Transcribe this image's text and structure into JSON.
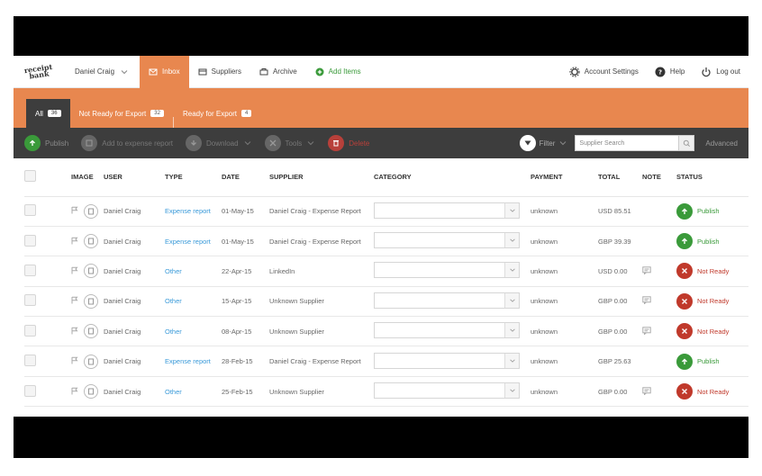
{
  "logo": {
    "line1": "receipt",
    "line2": "bank"
  },
  "topnav": {
    "user": "Daniel Craig",
    "tabs": [
      {
        "label": "Inbox",
        "icon": "inbox-icon"
      },
      {
        "label": "Suppliers",
        "icon": "suppliers-icon"
      },
      {
        "label": "Archive",
        "icon": "archive-icon"
      },
      {
        "label": "Add Items",
        "icon": "add-icon"
      }
    ],
    "right": [
      {
        "label": "Account Settings",
        "icon": "gear-icon"
      },
      {
        "label": "Help",
        "icon": "help-icon"
      },
      {
        "label": "Log out",
        "icon": "power-icon"
      }
    ]
  },
  "filter_tabs": [
    {
      "label": "All",
      "count": "36"
    },
    {
      "label": "Not Ready for Export",
      "count": "32"
    },
    {
      "label": "Ready for Export",
      "count": "4"
    }
  ],
  "toolbar": {
    "publish": "Publish",
    "add_to_report": "Add to expense report",
    "download": "Download",
    "tools": "Tools",
    "delete": "Delete",
    "filter": "Filter",
    "search_placeholder": "Supplier Search",
    "advanced": "Advanced"
  },
  "columns": {
    "image": "IMAGE",
    "user": "USER",
    "type": "TYPE",
    "date": "DATE",
    "supplier": "SUPPLIER",
    "category": "CATEGORY",
    "payment": "PAYMENT",
    "total": "TOTAL",
    "note": "NOTE",
    "status": "STATUS"
  },
  "rows": [
    {
      "user": "Daniel Craig",
      "type": "Expense report",
      "date": "01-May-15",
      "supplier": "Daniel Craig - Expense Report",
      "payment": "unknown",
      "total": "USD 85.51",
      "note": false,
      "status": "Publish",
      "status_kind": "publish"
    },
    {
      "user": "Daniel Craig",
      "type": "Expense report",
      "date": "01-May-15",
      "supplier": "Daniel Craig - Expense Report",
      "payment": "unknown",
      "total": "GBP 39.39",
      "note": false,
      "status": "Publish",
      "status_kind": "publish"
    },
    {
      "user": "Daniel Craig",
      "type": "Other",
      "date": "22-Apr-15",
      "supplier": "LinkedIn",
      "payment": "unknown",
      "total": "USD 0.00",
      "note": true,
      "status": "Not Ready",
      "status_kind": "notready"
    },
    {
      "user": "Daniel Craig",
      "type": "Other",
      "date": "15-Apr-15",
      "supplier": "Unknown Supplier",
      "payment": "unknown",
      "total": "GBP 0.00",
      "note": true,
      "status": "Not Ready",
      "status_kind": "notready"
    },
    {
      "user": "Daniel Craig",
      "type": "Other",
      "date": "08-Apr-15",
      "supplier": "Unknown Supplier",
      "payment": "unknown",
      "total": "GBP 0.00",
      "note": true,
      "status": "Not Ready",
      "status_kind": "notready"
    },
    {
      "user": "Daniel Craig",
      "type": "Expense report",
      "date": "28-Feb-15",
      "supplier": "Daniel Craig - Expense Report",
      "payment": "unknown",
      "total": "GBP 25.63",
      "note": false,
      "status": "Publish",
      "status_kind": "publish"
    },
    {
      "user": "Daniel Craig",
      "type": "Other",
      "date": "25-Feb-15",
      "supplier": "Unknown Supplier",
      "payment": "unknown",
      "total": "GBP 0.00",
      "note": true,
      "status": "Not Ready",
      "status_kind": "notready"
    }
  ],
  "colors": {
    "accent": "#e8874f",
    "toolbar": "#3d3d3d",
    "publish": "#3a9a3a",
    "notready": "#c0392b",
    "link": "#3a9ad9"
  }
}
